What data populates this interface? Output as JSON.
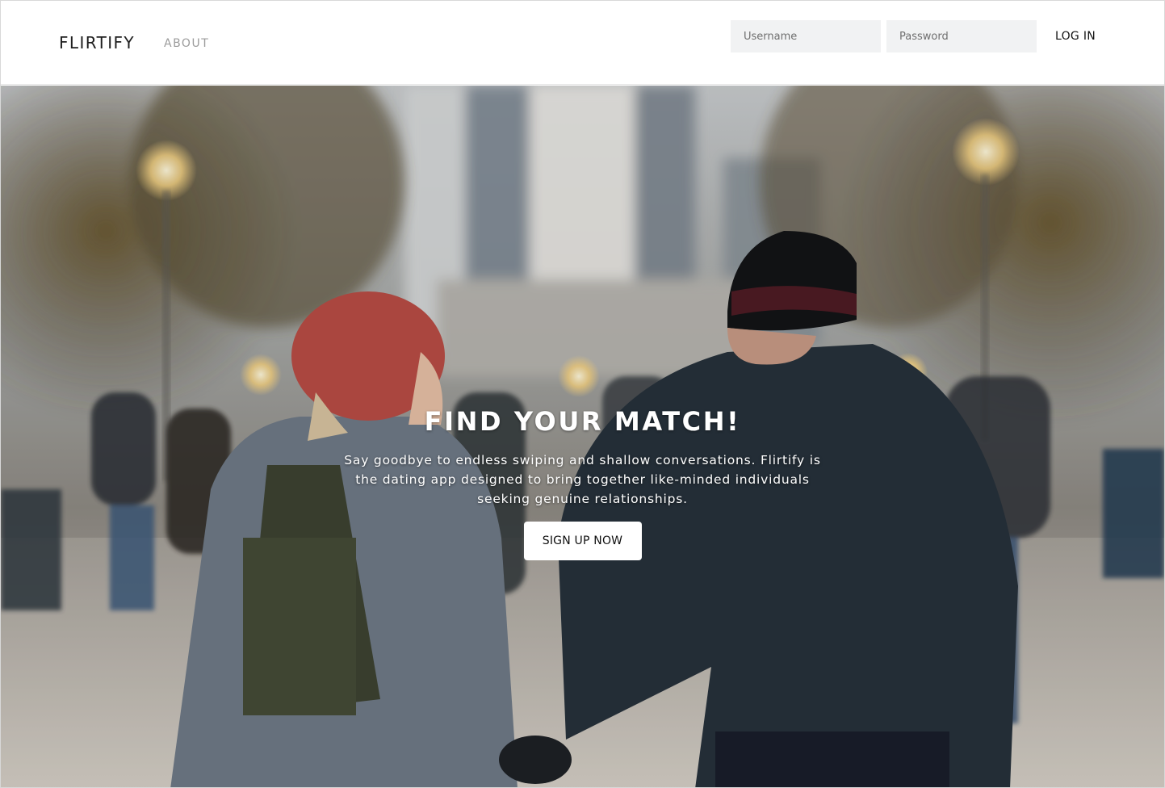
{
  "navbar": {
    "brand": "FLIRTIFY",
    "about_label": "ABOUT",
    "username_placeholder": "Username",
    "password_placeholder": "Password",
    "login_label": "LOG IN"
  },
  "hero": {
    "image_name": "couple-holding-hands-photo",
    "title": "FIND YOUR MATCH!",
    "description": "Say goodbye to endless swiping and shallow conversations. Flirtify is the dating app designed to bring together like-minded individuals seeking genuine relationships.",
    "cta_label": "SIGN UP NOW"
  }
}
